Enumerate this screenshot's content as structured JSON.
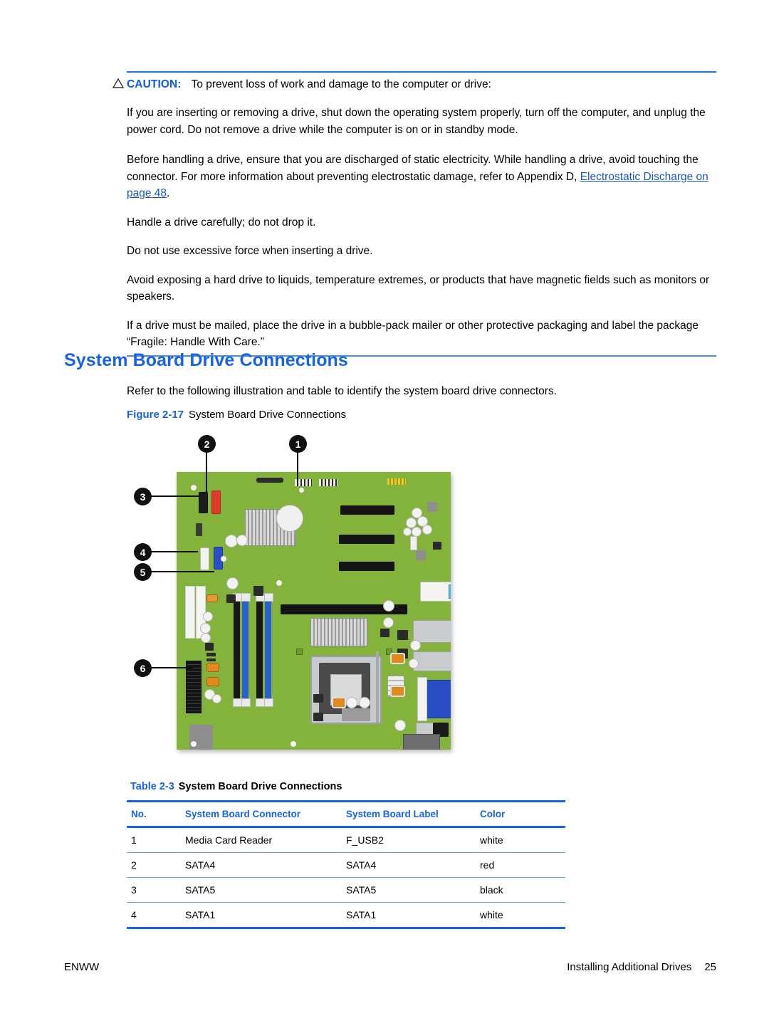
{
  "caution": {
    "icon": "warning-triangle-icon",
    "label": "CAUTION:",
    "lead": "To prevent loss of work and damage to the computer or drive:",
    "paragraphs": [
      "If you are inserting or removing a drive, shut down the operating system properly, turn off the computer, and unplug the power cord. Do not remove a drive while the computer is on or in standby mode.",
      "Handle a drive carefully; do not drop it.",
      "Do not use excessive force when inserting a drive.",
      "Avoid exposing a hard drive to liquids, temperature extremes, or products that have magnetic fields such as monitors or speakers.",
      "If a drive must be mailed, place the drive in a bubble-pack mailer or other protective packaging and label the package “Fragile: Handle With Care.”"
    ],
    "esd_paragraph": {
      "before": "Before handling a drive, ensure that you are discharged of static electricity. While handling a drive, avoid touching the connector. For more information about preventing electrostatic damage, refer to Appendix D, ",
      "link": "Electrostatic Discharge on page 48",
      "after": "."
    }
  },
  "section": {
    "heading": "System Board Drive Connections",
    "intro": "Refer to the following illustration and table to identify the system board drive connectors."
  },
  "figure": {
    "number": "Figure 2-17",
    "title": "System Board Drive Connections",
    "callouts": [
      {
        "id": "1",
        "label": "1"
      },
      {
        "id": "2",
        "label": "2"
      },
      {
        "id": "3",
        "label": "3"
      },
      {
        "id": "4",
        "label": "4"
      },
      {
        "id": "5",
        "label": "5"
      },
      {
        "id": "6",
        "label": "6"
      }
    ]
  },
  "table": {
    "number": "Table 2-3",
    "title": "System Board Drive Connections",
    "columns": [
      "No.",
      "System Board Connector",
      "System Board Label",
      "Color"
    ],
    "rows": [
      {
        "no": "1",
        "connector": "Media Card Reader",
        "label": "F_USB2",
        "color": "white"
      },
      {
        "no": "2",
        "connector": "SATA4",
        "label": "SATA4",
        "color": "red"
      },
      {
        "no": "3",
        "connector": "SATA5",
        "label": "SATA5",
        "color": "black"
      },
      {
        "no": "4",
        "connector": "SATA1",
        "label": "SATA1",
        "color": "white"
      }
    ]
  },
  "footer": {
    "left": "ENWW",
    "chapter": "Installing Additional Drives",
    "page": "25"
  },
  "colors": {
    "accent_blue": "#1763e8",
    "caution_blue": "#0a5ae8",
    "link_blue": "#1a56c4",
    "board_green": "#83b33a",
    "sata_red": "#e0392c",
    "sata_black": "#1c1c1c",
    "sata_white": "#f2f2ef",
    "sata_blue": "#2a4fc4"
  }
}
